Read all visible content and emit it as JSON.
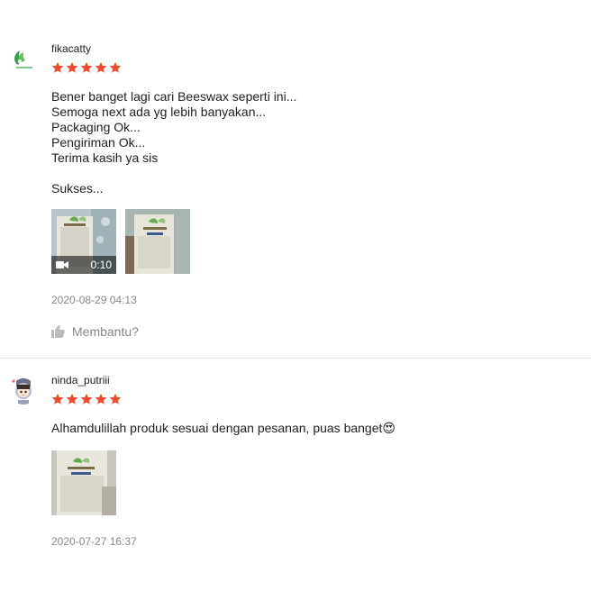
{
  "reviews": [
    {
      "username": "fikacatty",
      "rating": 5,
      "text": "Bener banget lagi cari Beeswax seperti ini...\nSemoga next ada yg lebih banyakan...\nPackaging Ok...\nPengiriman Ok...\nTerima kasih ya sis\n\nSukses...",
      "media": [
        {
          "type": "video",
          "duration": "0:10",
          "icon": "video-camera-icon"
        },
        {
          "type": "image"
        }
      ],
      "date": "2020-08-29 04:13",
      "helpful_label": "Membantu?"
    },
    {
      "username": "ninda_putriii",
      "rating": 5,
      "text": "Alhamdulillah produk sesuai dengan pesanan, puas banget😍",
      "media": [
        {
          "type": "image"
        }
      ],
      "date": "2020-07-27 16:37"
    }
  ],
  "colors": {
    "star": "#ee4d2d",
    "muted_text": "#888888",
    "divider": "#e5e5e5",
    "avatar_logo_green": "#3aa14a"
  },
  "icons": {
    "star": "star-icon",
    "thumbs_up": "thumbs-up-icon"
  }
}
